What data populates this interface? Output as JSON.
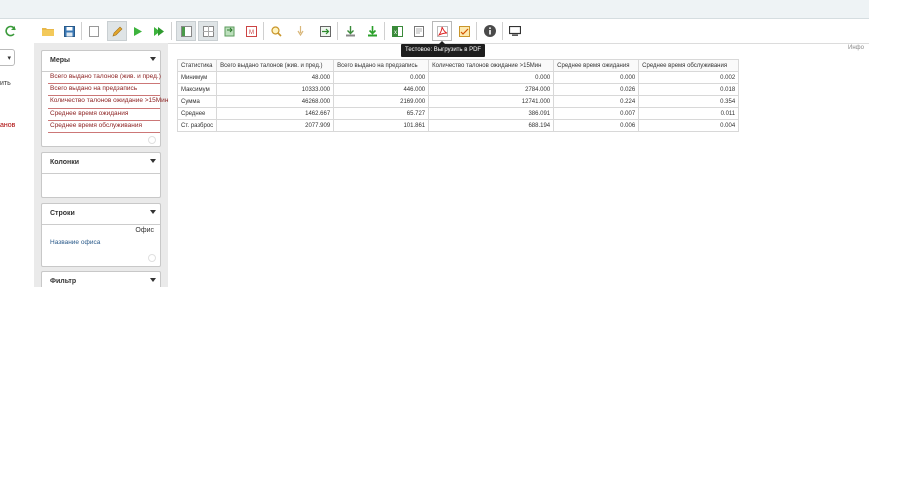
{
  "tooltip": "Тестовое: Выгрузить в PDF",
  "right_info": "Инфо",
  "left": {
    "dropdown_value": "▾",
    "text1": "ить",
    "text2": "анов"
  },
  "panels": {
    "measures": {
      "title": "Меры",
      "items": [
        "Всего выдано талонов (жив. и пред.)",
        "Всего выдано на предзапись",
        "Количество талонов ожидание >15Мин",
        "Среднее время ожидания",
        "Среднее время обслуживания"
      ]
    },
    "columns": {
      "title": "Колонки"
    },
    "rows": {
      "title": "Строки",
      "right_label": "Офис",
      "item": "Название офиса"
    },
    "filter": {
      "title": "Фильтр"
    }
  },
  "table": {
    "headers": [
      "Статистика",
      "Всего выдано талонов (жив. и пред.)",
      "Всего выдано на предзапись",
      "Количество талонов ожидание >15Мин",
      "Среднее время ожидания",
      "Среднее время обслуживания"
    ],
    "rows": [
      [
        "Минимум",
        "48.000",
        "0.000",
        "0.000",
        "0.000",
        "0.002"
      ],
      [
        "Максимум",
        "10333.000",
        "446.000",
        "2784.000",
        "0.026",
        "0.018"
      ],
      [
        "Сумма",
        "46268.000",
        "2169.000",
        "12741.000",
        "0.224",
        "0.354"
      ],
      [
        "Среднее",
        "1462.667",
        "65.727",
        "386.091",
        "0.007",
        "0.011"
      ],
      [
        "Ст. разброс",
        "2077.909",
        "101.861",
        "688.194",
        "0.006",
        "0.004"
      ]
    ]
  },
  "toolbar_icons": [
    "refresh-icon",
    "folder-open-icon",
    "save-icon",
    "new-document-icon",
    "edit-pencil-icon",
    "run-icon",
    "run-next-icon",
    "layout-left-icon",
    "layout-grid-icon",
    "swap-icon",
    "mdx-icon",
    "zoom-icon",
    "sort-down-icon",
    "export-icon",
    "download-icon",
    "download-green-icon",
    "excel-icon",
    "csv-icon",
    "pdf-icon",
    "report-icon",
    "info-icon",
    "screen-icon"
  ],
  "colors": {
    "measure_text": "#8b1f1f",
    "row_item_text": "#2a5a8a",
    "tooltip_bg": "#1e1e1e"
  }
}
